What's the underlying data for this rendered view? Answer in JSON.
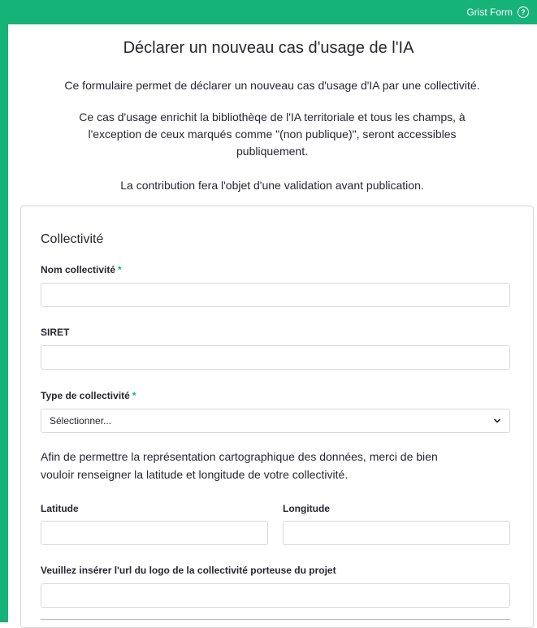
{
  "header": {
    "brand": "Grist Form",
    "help_icon": "help-circle-icon",
    "accent_color": "#16b378"
  },
  "form": {
    "title": "Déclarer un nouveau cas d'usage de l'IA",
    "intro_1": "Ce formulaire permet de déclarer un nouveau cas d'usage d'IA par une collectivité.",
    "intro_2a": "Ce cas d'usage enrichit la bibliothèqe de l'IA territoriale et tous les champs, à",
    "intro_2b": "l'exception de ceux marqués comme \"(non publique)\", seront accessibles",
    "intro_2c": "publiquement.",
    "intro_3": "La contribution fera l'objet d'une validation avant publication.",
    "section": "Collectivité",
    "fields": {
      "nom": {
        "label": "Nom collectivité",
        "required_mark": "*",
        "value": ""
      },
      "siret": {
        "label": "SIRET",
        "value": ""
      },
      "type": {
        "label": "Type de collectivité",
        "required_mark": "*",
        "selected": "Sélectionner..."
      },
      "latitude": {
        "label": "Latitude",
        "value": ""
      },
      "longitude": {
        "label": "Longitude",
        "value": ""
      },
      "logo": {
        "label": "Veuillez insérer l'url du logo de la collectivité porteuse du projet",
        "value": ""
      }
    },
    "geo_note_a": "Afin de permettre la représentation cartographique des données, merci de bien",
    "geo_note_b": "vouloir renseigner la latitude et longitude de votre collectivité."
  }
}
